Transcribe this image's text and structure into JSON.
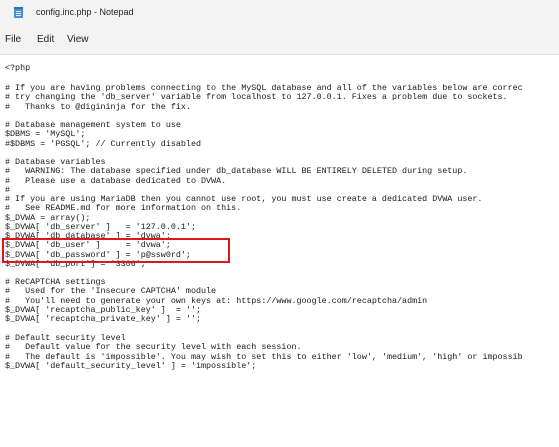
{
  "window": {
    "title": "config.inc.php - Notepad"
  },
  "menu": {
    "file": "File",
    "edit": "Edit",
    "view": "View"
  },
  "editor": {
    "lines": [
      "<?php",
      "",
      "# If you are having problems connecting to the MySQL database and all of the variables below are correc",
      "# try changing the 'db_server' variable from localhost to 127.0.0.1. Fixes a problem due to sockets.",
      "#   Thanks to @digininja for the fix.",
      "",
      "# Database management system to use",
      "$DBMS = 'MySQL';",
      "#$DBMS = 'PGSQL'; // Currently disabled",
      "",
      "# Database variables",
      "#   WARNING: The database specified under db_database WILL BE ENTIRELY DELETED during setup.",
      "#   Please use a database dedicated to DVWA.",
      "#",
      "# If you are using MariaDB then you cannot use root, you must use create a dedicated DVWA user.",
      "#   See README.md for more information on this.",
      "$_DVWA = array();",
      "$_DVWA[ 'db_server' ]   = '127.0.0.1';",
      "$_DVWA[ 'db_database' ] = 'dvwa';",
      "$_DVWA[ 'db_user' ]     = 'dvwa';",
      "$_DVWA[ 'db_password' ] = 'p@ssw0rd';",
      "$_DVWA[ 'db_port'] = '3306';",
      "",
      "# ReCAPTCHA settings",
      "#   Used for the 'Insecure CAPTCHA' module",
      "#   You'll need to generate your own keys at: https://www.google.com/recaptcha/admin",
      "$_DVWA[ 'recaptcha_public_key' ]  = '';",
      "$_DVWA[ 'recaptcha_private_key' ] = '';",
      "",
      "# Default security level",
      "#   Default value for the security level with each session.",
      "#   The default is 'impossible'. You may wish to set this to either 'low', 'medium', 'high' or impossib",
      "$_DVWA[ 'default_security_level' ] = 'impossible';"
    ]
  },
  "colors": {
    "highlight_border": "#e0161d",
    "chrome_background": "#f3f3f3",
    "editor_background": "#ffffff",
    "text": "#1a1a1a"
  }
}
